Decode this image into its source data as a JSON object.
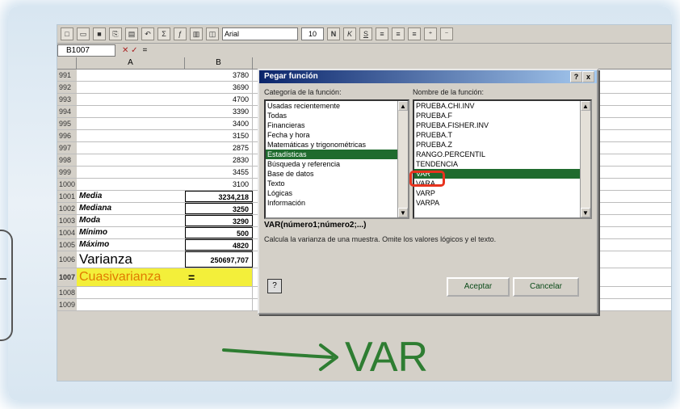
{
  "toolbar": {
    "font_name": "Arial",
    "font_size": "10"
  },
  "formula_bar": {
    "name_box": "B1007",
    "content": "="
  },
  "columns": [
    "A",
    "B"
  ],
  "rows": [
    {
      "n": "991",
      "a": "",
      "b": "3780"
    },
    {
      "n": "992",
      "a": "",
      "b": "3690"
    },
    {
      "n": "993",
      "a": "",
      "b": "4700"
    },
    {
      "n": "994",
      "a": "",
      "b": "3390"
    },
    {
      "n": "995",
      "a": "",
      "b": "3400"
    },
    {
      "n": "996",
      "a": "",
      "b": "3150"
    },
    {
      "n": "997",
      "a": "",
      "b": "2875"
    },
    {
      "n": "998",
      "a": "",
      "b": "2830"
    },
    {
      "n": "999",
      "a": "",
      "b": "3455"
    },
    {
      "n": "1000",
      "a": "",
      "b": "3100"
    }
  ],
  "stats": [
    {
      "n": "1001",
      "a": "Media",
      "b": "3234,218"
    },
    {
      "n": "1002",
      "a": "Mediana",
      "b": "3250"
    },
    {
      "n": "1003",
      "a": "Moda",
      "b": "3290"
    },
    {
      "n": "1004",
      "a": "Mínimo",
      "b": "500"
    },
    {
      "n": "1005",
      "a": "Máximo",
      "b": "4820"
    }
  ],
  "varianza_row": {
    "n": "1006",
    "a": "Varianza",
    "b": "250697,707"
  },
  "cuasi_row": {
    "n": "1007",
    "a": "Cuasivarianza",
    "b": "="
  },
  "extra_rows": [
    "1008",
    "1009"
  ],
  "dialog": {
    "title": "Pegar función",
    "category_label": "Categoría de la función:",
    "function_label": "Nombre de la función:",
    "categories": [
      "Usadas recientemente",
      "Todas",
      "Financieras",
      "Fecha y hora",
      "Matemáticas y trigonométricas",
      "Estadísticas",
      "Búsqueda y referencia",
      "Base de datos",
      "Texto",
      "Lógicas",
      "Información"
    ],
    "selected_category": "Estadísticas",
    "functions": [
      "PRUEBA.CHI.INV",
      "PRUEBA.F",
      "PRUEBA.FISHER.INV",
      "PRUEBA.T",
      "PRUEBA.Z",
      "RANGO.PERCENTIL",
      "TENDENCIA",
      "VAR",
      "VARA",
      "VARP",
      "VARPA"
    ],
    "selected_function": "VAR",
    "syntax": "VAR(número1;número2;...)",
    "description": "Calcula la varianza de una muestra. Omite los valores lógicos y el texto.",
    "ok_button": "Aceptar",
    "cancel_button": "Cancelar",
    "help_glyph": "?",
    "close_glyph": "x"
  },
  "annotation": {
    "text": "VAR",
    "color": "#2e7d32"
  }
}
